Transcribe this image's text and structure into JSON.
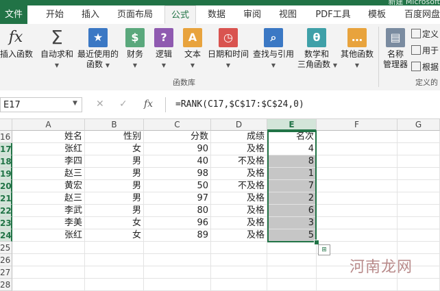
{
  "window": {
    "title_fragment": "新建 Microsoft"
  },
  "tabs": [
    "文件",
    "开始",
    "插入",
    "页面布局",
    "公式",
    "数据",
    "审阅",
    "视图",
    "PDF工具",
    "模板",
    "百度网盘"
  ],
  "active_tab": "公式",
  "ribbon": {
    "buttons": [
      {
        "line1": "插入函数",
        "line2": "",
        "icon": "fx"
      },
      {
        "line1": "自动求和",
        "line2": "",
        "icon": "Σ"
      },
      {
        "line1": "最近使用的",
        "line2": "函数",
        "icon": "★"
      },
      {
        "line1": "财务",
        "line2": "",
        "icon": "$"
      },
      {
        "line1": "逻辑",
        "line2": "",
        "icon": "?"
      },
      {
        "line1": "文本",
        "line2": "",
        "icon": "A"
      },
      {
        "line1": "日期和时间",
        "line2": "",
        "icon": "◷"
      },
      {
        "line1": "查找与引用",
        "line2": "",
        "icon": "⌕"
      },
      {
        "line1": "数学和",
        "line2": "三角函数",
        "icon": "θ"
      },
      {
        "line1": "其他函数",
        "line2": "",
        "icon": "…"
      },
      {
        "line1": "名称",
        "line2": "管理器",
        "icon": "▤"
      }
    ],
    "small_items": [
      "定义",
      "用于",
      "根据"
    ],
    "group_labels": [
      "函数库",
      "定义的"
    ]
  },
  "formula_bar": {
    "name_box": "E17",
    "fx": "fx",
    "formula": "=RANK(C17,$C$17:$C$24,0)"
  },
  "columns": [
    "A",
    "B",
    "C",
    "D",
    "E",
    "F",
    "G"
  ],
  "active_column": "E",
  "row_numbers": [
    "16",
    "17",
    "18",
    "19",
    "20",
    "21",
    "22",
    "23",
    "24",
    "25",
    "26",
    "27",
    "28"
  ],
  "table": {
    "header": [
      "姓名",
      "性别",
      "分数",
      "成绩",
      "名次"
    ],
    "rows": [
      [
        "张红",
        "女",
        "90",
        "及格",
        "4"
      ],
      [
        "李四",
        "男",
        "40",
        "不及格",
        "8"
      ],
      [
        "赵三",
        "男",
        "98",
        "及格",
        "1"
      ],
      [
        "黄宏",
        "男",
        "50",
        "不及格",
        "7"
      ],
      [
        "赵三",
        "男",
        "97",
        "及格",
        "2"
      ],
      [
        "李武",
        "男",
        "80",
        "及格",
        "6"
      ],
      [
        "李美",
        "女",
        "96",
        "及格",
        "3"
      ],
      [
        "张红",
        "女",
        "89",
        "及格",
        "5"
      ]
    ]
  },
  "watermark": "河南龙网"
}
